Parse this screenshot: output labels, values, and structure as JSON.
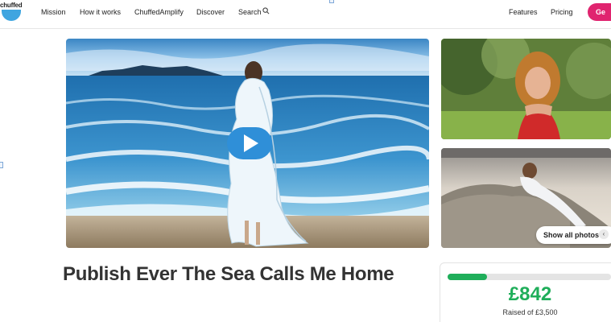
{
  "nav": {
    "logo_text": "chuffed",
    "links": [
      "Mission",
      "How it works",
      "ChuffedAmplify",
      "Discover",
      "Search"
    ],
    "right_links": [
      "Features",
      "Pricing"
    ],
    "cta_label": "Ge",
    "search_icon": "search-icon"
  },
  "gallery": {
    "show_all_label": "Show all photos",
    "show_all_icon_glyph": "‹"
  },
  "campaign": {
    "title": "Publish Ever The Sea Calls Me Home",
    "raised_amount": "£842",
    "raised_of": "Raised of £3,500",
    "progress_fraction": 0.24
  },
  "colors": {
    "accent_pink": "#e0246f",
    "progress_green": "#1fae5a",
    "play_blue": "#2f8fd8"
  }
}
